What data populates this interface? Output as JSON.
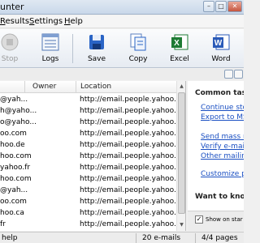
{
  "window": {
    "title": "unter"
  },
  "menu": [
    {
      "label": "Results",
      "underline": "R",
      "rest": "esults"
    },
    {
      "label": "Settings",
      "underline": "S",
      "rest": "ettings"
    },
    {
      "label": "Help",
      "underline": "H",
      "rest": "elp"
    }
  ],
  "toolbar": {
    "stop_label": "Stop",
    "logs_label": "Logs",
    "save_label": "Save",
    "copy_label": "Copy",
    "excel_label": "Excel",
    "word_label": "Word"
  },
  "table": {
    "columns": [
      "Owner",
      "Location"
    ],
    "rows": [
      {
        "email": "@yah...",
        "location": "http://email.people.yahoo.c"
      },
      {
        "email": "h@yaho...",
        "location": "http://email.people.yahoo.c"
      },
      {
        "email": "o@yaho...",
        "location": "http://email.people.yahoo.c"
      },
      {
        "email": "oo.com",
        "location": "http://email.people.yahoo.c"
      },
      {
        "email": "hoo.de",
        "location": "http://email.people.yahoo.c"
      },
      {
        "email": "hoo.com",
        "location": "http://email.people.yahoo.c"
      },
      {
        "email": "yahoo.fr",
        "location": "http://email.people.yahoo.c"
      },
      {
        "email": "hoo.com",
        "location": "http://email.people.yahoo.c"
      },
      {
        "email": "@yah...",
        "location": "http://email.people.yahoo.c"
      },
      {
        "email": "oo.com",
        "location": "http://email.people.yahoo.c"
      },
      {
        "email": "hoo.ca",
        "location": "http://email.people.yahoo.c"
      },
      {
        "email": "fr",
        "location": "http://email.people.yahoo.c"
      }
    ]
  },
  "task_pane": {
    "heading": "Common tas",
    "links_group1": [
      "Continue sto",
      "Export to MS"
    ],
    "links_group2": [
      "Send mass n",
      "Verify e-mai",
      "Other mailin"
    ],
    "links_group3": [
      "Customize p"
    ],
    "heading2": "Want to know",
    "checkbox_label": "Show on star",
    "checkbox_checked": true
  },
  "status": {
    "help": "help",
    "emails": "20 e-mails",
    "pages": "4/4 pages"
  },
  "colors": {
    "link": "#1a4fc2",
    "excel": "#1e7b34",
    "word": "#2a5ab8",
    "save": "#2a64c5"
  }
}
